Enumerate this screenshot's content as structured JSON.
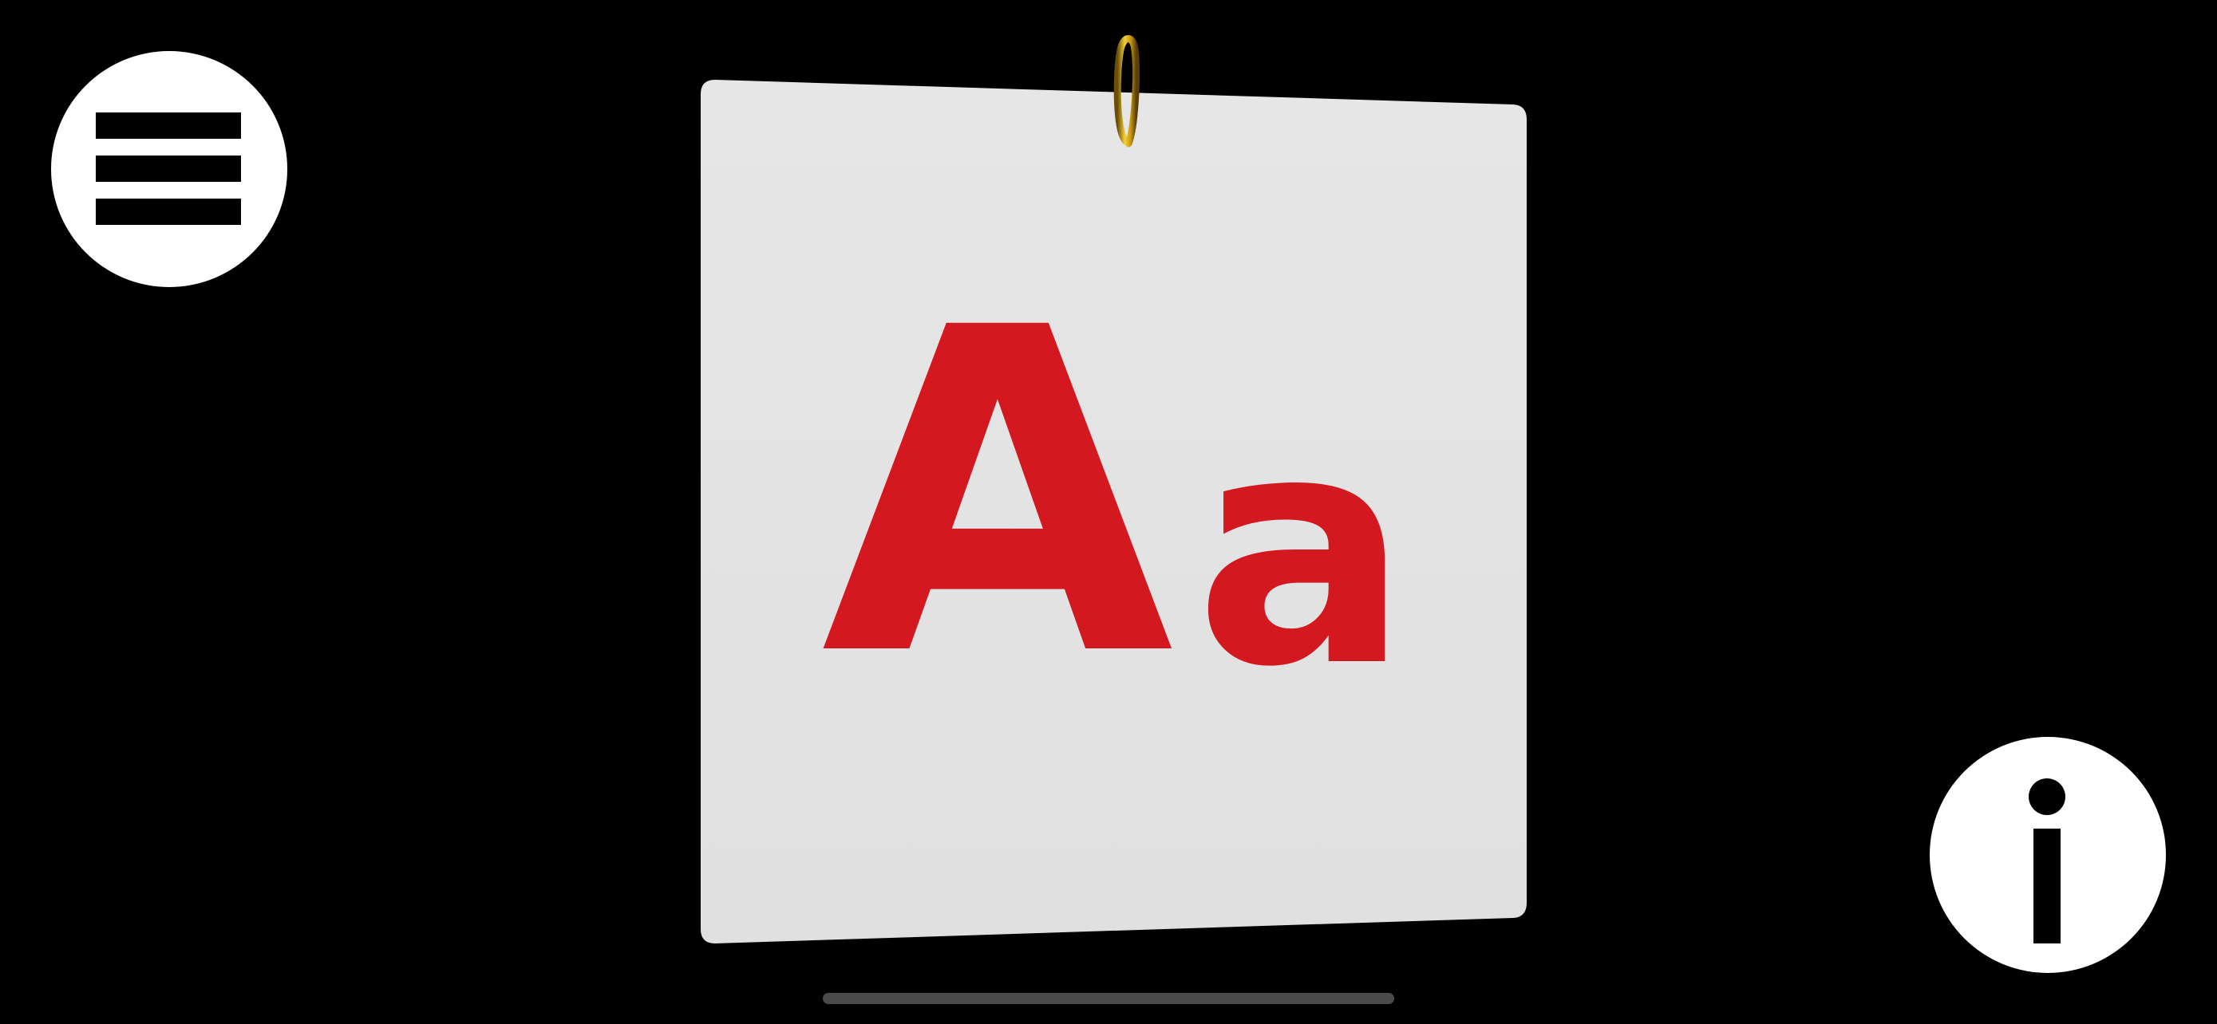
{
  "card": {
    "upper": "A",
    "lower": "a",
    "letter_color": "#d4181f",
    "card_color": "#e4e4e4",
    "ring_color": "#d9b21f"
  },
  "buttons": {
    "menu_icon": "hamburger-menu-icon",
    "info_icon": "info-icon"
  },
  "colors": {
    "background": "#000000",
    "button_fill": "#ffffff",
    "home_indicator": "#4a4a4a"
  }
}
